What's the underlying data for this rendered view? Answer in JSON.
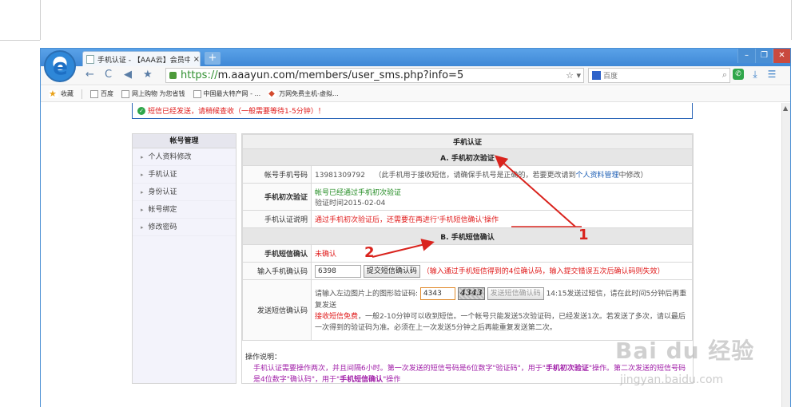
{
  "browser": {
    "tab_title": "手机认证 - 【AAA云】会员中",
    "tab_close": "×",
    "new_tab": "+",
    "url_prefix": "https://",
    "url_rest": "m.aaayun.com/members/user_sms.php?info=5",
    "search_placeholder": "百度",
    "bookmarks": [
      {
        "label": "收藏"
      },
      {
        "label": "百度"
      },
      {
        "label": "网上购物 为您省钱"
      },
      {
        "label": "中国最大特产网 - ..."
      },
      {
        "label": "万网免费主机-虚拟..."
      }
    ]
  },
  "notice": "短信已经发送，请稍候查收（一般需要等待1-5分钟）！",
  "sidebar": {
    "title": "帐号管理",
    "items": [
      "个人资料修改",
      "手机认证",
      "身份认证",
      "帐号绑定",
      "修改密码"
    ]
  },
  "main": {
    "title": "手机认证",
    "section_a": "A. 手机初次验证",
    "phone_label": "帐号手机号码",
    "phone_number": "13981309792",
    "phone_note_1": "（此手机用于接收短信，请确保手机号是正确的，若要更改请到",
    "phone_note_link": "个人资料管理",
    "phone_note_2": "中修改）",
    "first_verify_label": "手机初次验证",
    "first_verify_status": "帐号已经通过手机初次验证",
    "first_verify_time": "验证时间2015-02-04",
    "explain_label": "手机认证说明",
    "explain_text": "通过手机初次验证后，还需要在再进行'手机短信确认'操作",
    "section_b": "B. 手机短信确认",
    "sms_confirm_label": "手机短信确认",
    "sms_confirm_status": "未确认",
    "code_label": "输入手机确认码",
    "code_value": "6398",
    "code_submit": "提交短信确认码",
    "code_hint": "（输入通过手机短信得到的4位确认码，输入提交错误五次后确认码则失效）",
    "send_label": "发送短信确认码",
    "captcha_prompt": "请输入左边图片上的图形验证码:",
    "captcha_value": "4343",
    "captcha_image_text": "4343",
    "send_button": "发送短信确认码",
    "send_status": "14:15发送过短信，请在此时间5分钟后再重复发送",
    "free_label": "接收短信免费",
    "free_text": "，一般2-10分钟可以收到短信。一个帐号只能发送5次验证码，已经发送1次。若发送了多次，请以最后一次得到的验证码为准。必须在上一次发送5分钟之后再能重复发送第二次。",
    "help_title": "操作说明：",
    "help_text_1": "手机认证需要操作两次，并且间隔6小时。第一次发送的短信号码是6位数字\"验证码\"，用于\"",
    "help_bold_1": "手机初次验证",
    "help_text_2": "\"操作。第二次发送的短信号码是4位数字\"确认码\"，用于\"",
    "help_bold_2": "手机短信确认",
    "help_text_3": "\"操作"
  },
  "annotations": {
    "one": "1",
    "two": "2",
    "color": "#d9231d"
  },
  "watermark": {
    "brand": "Bai du 经验",
    "url": "jingyan.baidu.com"
  }
}
